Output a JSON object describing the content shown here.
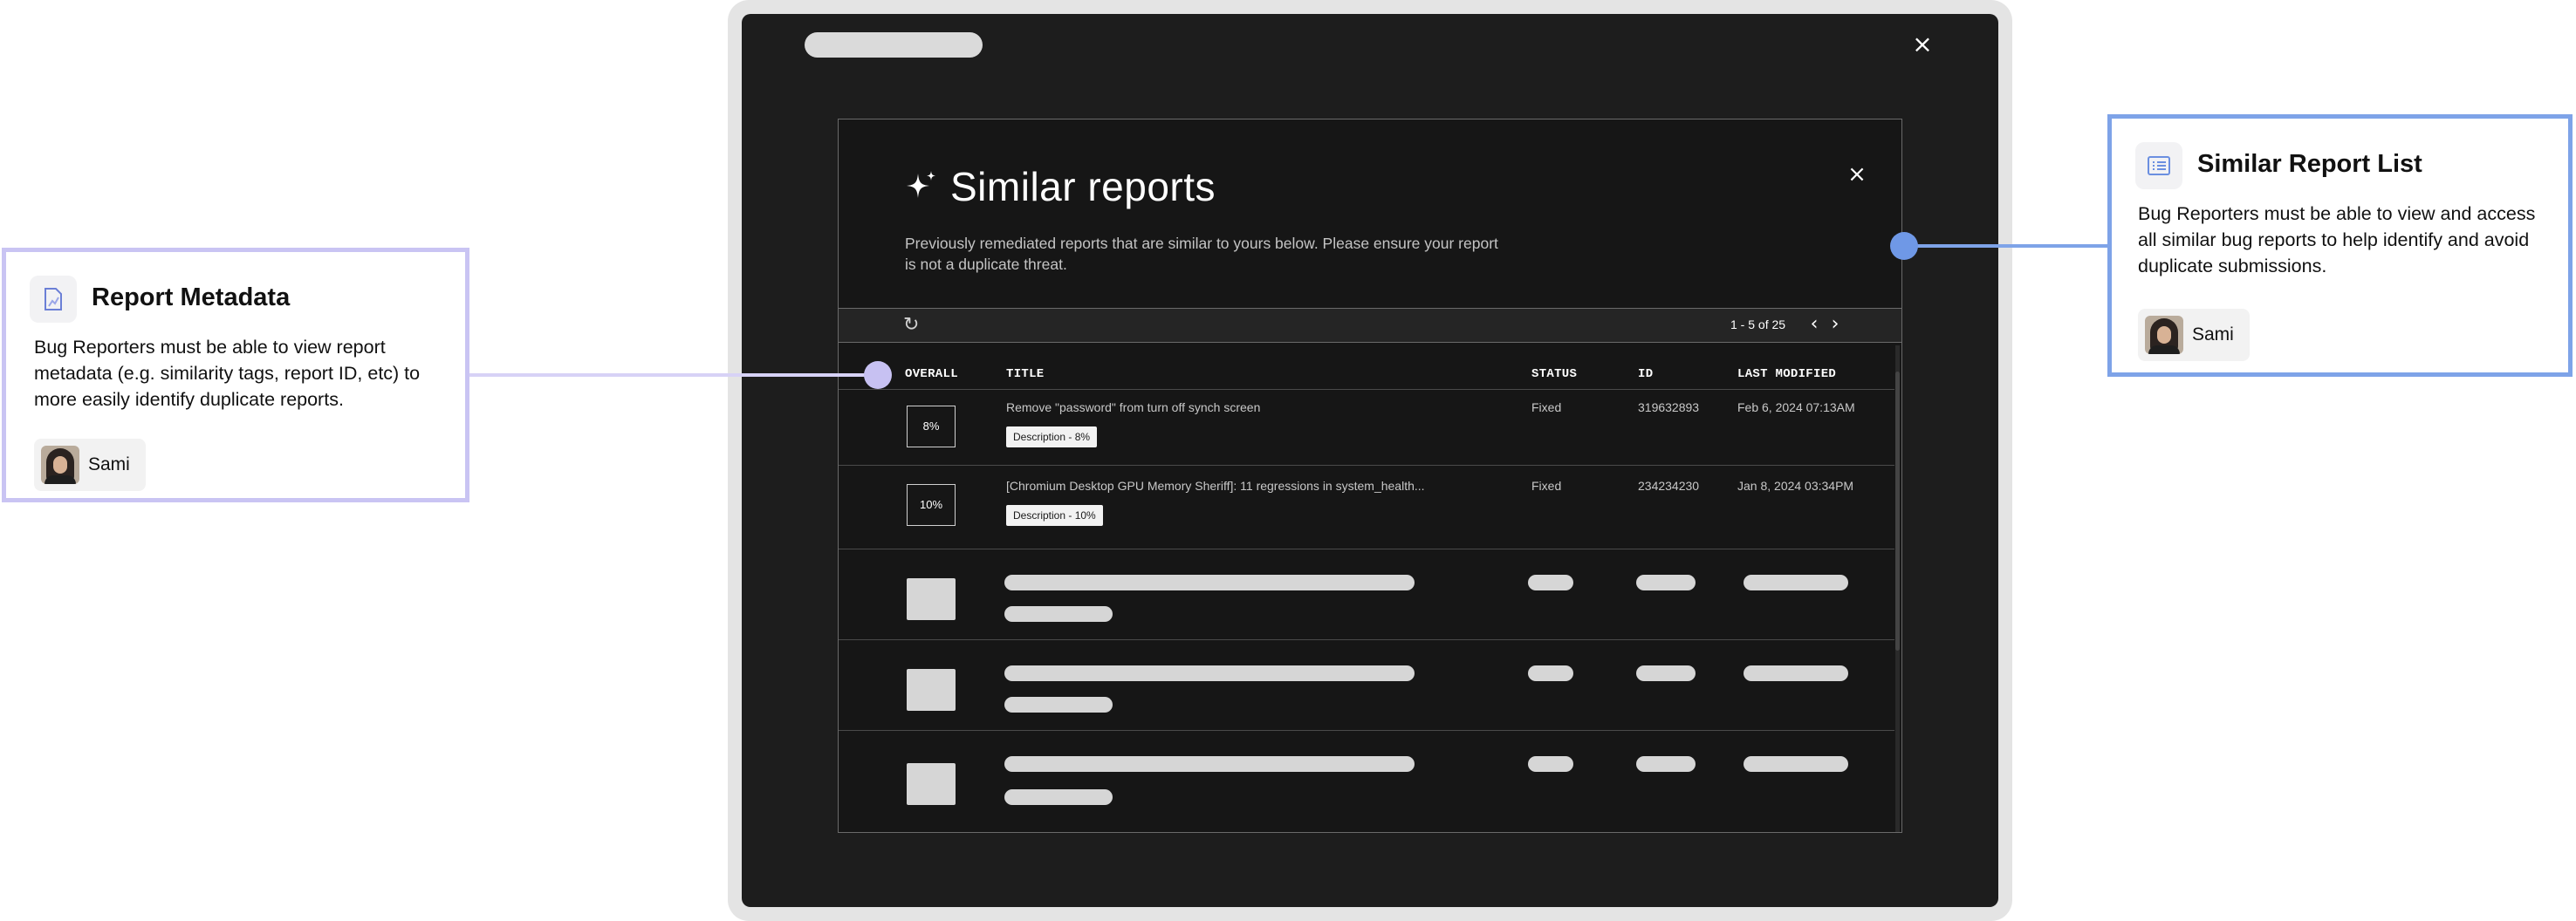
{
  "dialog": {
    "title": "Similar reports",
    "description": "Previously remediated reports that are similar to yours below. Please ensure your report is not a duplicate threat.",
    "close_label": "×"
  },
  "screen": {
    "close_label": "×"
  },
  "toolbar": {
    "refresh_icon": "↻",
    "pagination": "1 - 5 of 25",
    "prev_label": "‹",
    "next_label": "›"
  },
  "table": {
    "columns": [
      "OVERALL",
      "TITLE",
      "STATUS",
      "ID",
      "LAST MODIFIED"
    ],
    "rows": [
      {
        "overall": "8%",
        "title": "Remove \"password\" from turn off synch screen",
        "tag": "Description - 8%",
        "status": "Fixed",
        "id": "319632893",
        "last_modified": "Feb 6, 2024 07:13AM"
      },
      {
        "overall": "10%",
        "title": "[Chromium Desktop GPU Memory Sheriff]: 11 regressions in system_health...",
        "tag": "Description - 10%",
        "status": "Fixed",
        "id": "234234230",
        "last_modified": "Jan 8, 2024 03:34PM"
      }
    ],
    "skeleton_rows": 3
  },
  "annotations": {
    "left": {
      "title": "Report Metadata",
      "body": "Bug Reporters must be able to view report metadata (e.g. similarity tags, report ID, etc) to more easily identify duplicate reports.",
      "person": "Sami",
      "icon": "report-icon",
      "color": "#c9c4f3"
    },
    "right": {
      "title": "Similar Report List",
      "body": "Bug Reporters must be able to view and access all similar bug reports to help identify and avoid duplicate submissions.",
      "person": "Sami",
      "icon": "list-icon",
      "color": "#7ea3e8"
    }
  },
  "colors": {
    "screen_bg": "#1d1d1d",
    "dialog_bg": "#161616",
    "skeleton": "#d6d6d6"
  }
}
